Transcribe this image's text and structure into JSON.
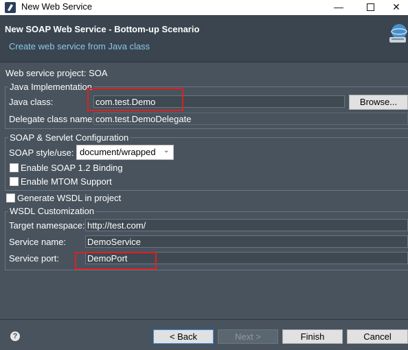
{
  "window": {
    "title": "New Web Service"
  },
  "header": {
    "title": "New SOAP Web Service - Bottom-up Scenario",
    "subtitle": "Create web service from Java class"
  },
  "project_label": "Web service project: SOA",
  "java_impl": {
    "group_title": "Java Implementation",
    "java_class_label": "Java class:",
    "java_class_value": "com.test.Demo",
    "browse_label": "Browse...",
    "delegate_label": "Delegate class name:",
    "delegate_value": "com.test.DemoDelegate"
  },
  "soap": {
    "group_title": "SOAP & Servlet Configuration",
    "style_label": "SOAP style/use:",
    "style_value": "document/wrapped",
    "soap12_label": "Enable SOAP 1.2 Binding",
    "soap12_checked": false,
    "mtom_label": "Enable MTOM Support",
    "mtom_checked": false
  },
  "generate_wsdl": {
    "label": "Generate WSDL in project",
    "checked": false
  },
  "wsdl": {
    "group_title": "WSDL Customization",
    "namespace_label": "Target namespace:",
    "namespace_value": "http://test.com/",
    "service_label": "Service name:",
    "service_value": "DemoService",
    "port_label": "Service port:",
    "port_value": "DemoPort"
  },
  "footer": {
    "help_glyph": "?",
    "back_label": "< Back",
    "next_label": "Next >",
    "finish_label": "Finish",
    "cancel_label": "Cancel"
  },
  "icons": {
    "app": "eclipse-icon",
    "minimize": "minimize-icon",
    "maximize": "maximize-icon",
    "close": "close-icon",
    "wizard": "wizard-banner-icon",
    "help": "help-icon",
    "dropdown": "chevron-down-icon"
  },
  "colors": {
    "background": "#48535d",
    "header_subtitle": "#8bc7e8",
    "highlight_box": "#e02020"
  }
}
